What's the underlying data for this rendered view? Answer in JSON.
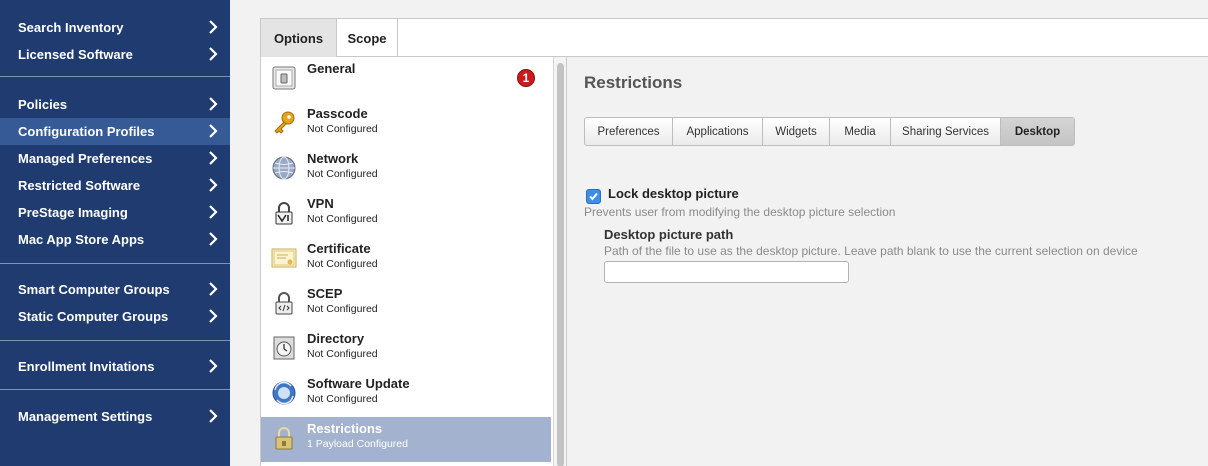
{
  "sidebar": {
    "items": [
      {
        "label": "Search Inventory"
      },
      {
        "label": "Licensed Software"
      },
      {
        "label": "Policies"
      },
      {
        "label": "Configuration Profiles",
        "active": true
      },
      {
        "label": "Managed Preferences"
      },
      {
        "label": "Restricted Software"
      },
      {
        "label": "PreStage Imaging"
      },
      {
        "label": "Mac App Store Apps"
      },
      {
        "label": "Smart Computer Groups"
      },
      {
        "label": "Static Computer Groups"
      },
      {
        "label": "Enrollment Invitations"
      },
      {
        "label": "Management Settings"
      }
    ]
  },
  "top_tabs": [
    {
      "label": "Options",
      "active": true
    },
    {
      "label": "Scope"
    }
  ],
  "payloads": [
    {
      "title": "General",
      "subtitle": "",
      "icon": "switch-icon",
      "badge": "1"
    },
    {
      "title": "Passcode",
      "subtitle": "Not Configured",
      "icon": "key-icon"
    },
    {
      "title": "Network",
      "subtitle": "Not Configured",
      "icon": "globe-icon"
    },
    {
      "title": "VPN",
      "subtitle": "Not Configured",
      "icon": "vpn-lock-icon"
    },
    {
      "title": "Certificate",
      "subtitle": "Not Configured",
      "icon": "certificate-icon"
    },
    {
      "title": "SCEP",
      "subtitle": "Not Configured",
      "icon": "scep-lock-icon"
    },
    {
      "title": "Directory",
      "subtitle": "Not Configured",
      "icon": "directory-icon"
    },
    {
      "title": "Software Update",
      "subtitle": "Not Configured",
      "icon": "software-update-icon"
    },
    {
      "title": "Restrictions",
      "subtitle": "1 Payload Configured",
      "icon": "restrictions-lock-icon",
      "selected": true
    }
  ],
  "content": {
    "title": "Restrictions",
    "subtabs": [
      {
        "label": "Preferences"
      },
      {
        "label": "Applications"
      },
      {
        "label": "Widgets"
      },
      {
        "label": "Media"
      },
      {
        "label": "Sharing Services"
      },
      {
        "label": "Desktop",
        "active": true
      }
    ],
    "lock_desktop": {
      "label": "Lock desktop picture",
      "checked": true,
      "help": "Prevents user from modifying the desktop picture selection"
    },
    "desktop_path": {
      "label": "Desktop picture path",
      "help": "Path of the file to use as the desktop picture. Leave path blank to use the current selection on device",
      "value": ""
    }
  },
  "colors": {
    "sidebar_bg": "#1f3b6f",
    "sidebar_active": "#355a95",
    "selected_payload": "#a3b3cf",
    "badge": "#cc1b1b",
    "checkbox": "#3d8ee6"
  }
}
